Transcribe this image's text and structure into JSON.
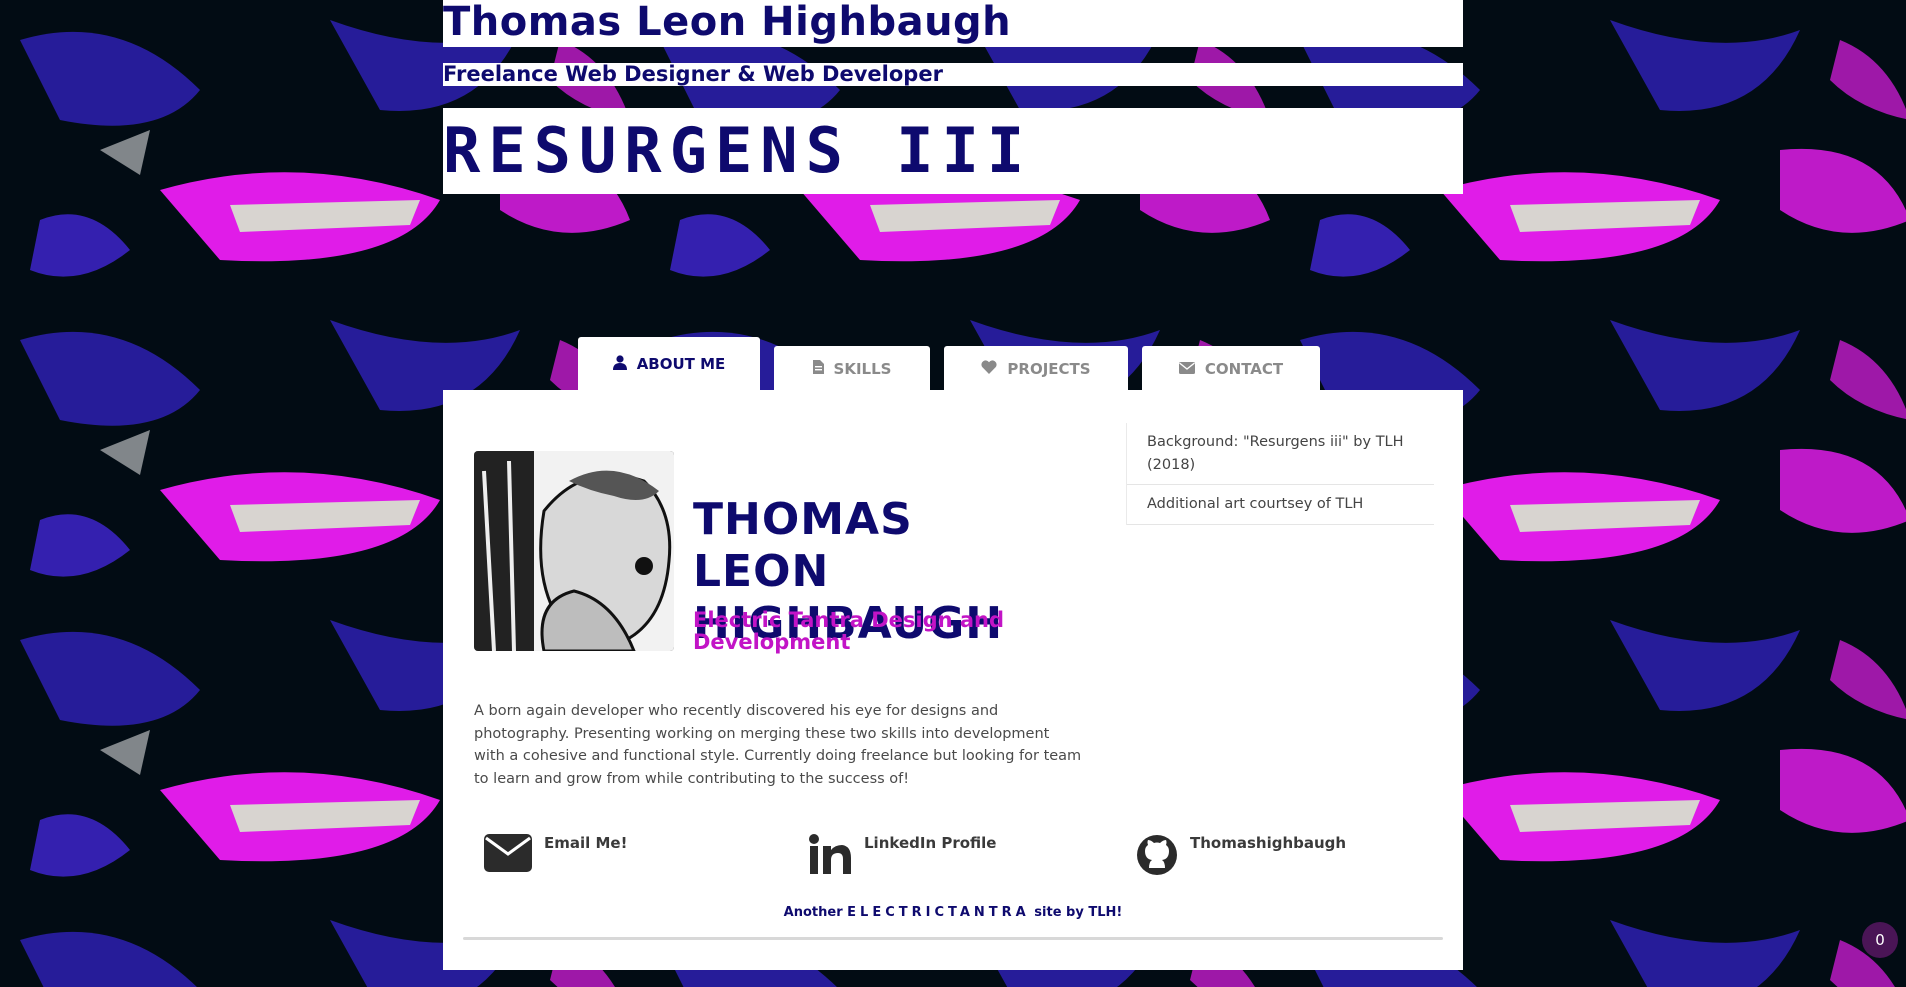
{
  "header": {
    "title": "Thomas Leon Highbaugh",
    "subtitle": "Freelance Web Designer & Web Developer",
    "banner": "RESURGENS III"
  },
  "tabs": [
    {
      "label": "ABOUT ME",
      "icon": "user-icon",
      "active": true
    },
    {
      "label": "SKILLS",
      "icon": "file-icon",
      "active": false
    },
    {
      "label": "PROJECTS",
      "icon": "heart-icon",
      "active": false
    },
    {
      "label": "CONTACT",
      "icon": "envelope-icon",
      "active": false
    }
  ],
  "profile": {
    "name": "THOMAS LEON HIGHBAUGH",
    "tagline": "Electric Tantra Design and Development",
    "bio": "A born again developer who recently discovered his eye for designs and photography. Presenting working on merging these two skills into development with a cohesive and functional style. Currently doing freelance but looking for team to learn and grow from while contributing to the success of!"
  },
  "sidebar": {
    "items": [
      {
        "label": "Background: \"Resurgens iii\" by TLH (2018)"
      },
      {
        "label": "Additional art courtsey of TLH"
      }
    ]
  },
  "contacts": [
    {
      "label": "Email Me!",
      "icon": "envelope-icon"
    },
    {
      "label": "LinkedIn Profile",
      "icon": "linkedin-icon"
    },
    {
      "label": "Thomashighbaugh",
      "icon": "github-icon"
    }
  ],
  "footer": {
    "prefix": "Another",
    "brand": "ELECTRICTANTRA",
    "suffix": "site by TLH!"
  },
  "badge": {
    "count": "0"
  },
  "colors": {
    "primary": "#0e0a6e",
    "accent": "#c214c6",
    "background": "#020c14",
    "art_magenta": "#e01ce8",
    "art_blue": "#2a1ea8"
  }
}
